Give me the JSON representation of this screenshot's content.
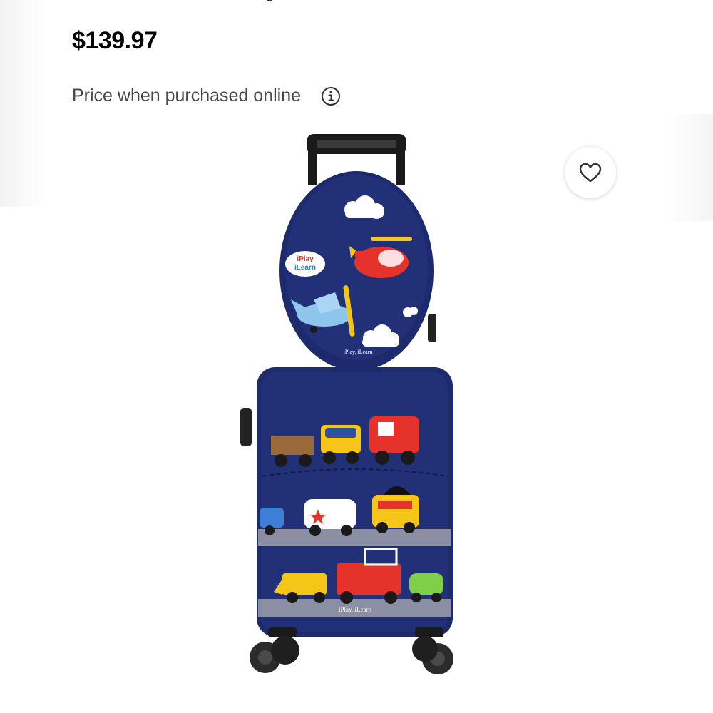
{
  "product": {
    "price": "$139.97",
    "price_note": "Price when purchased online",
    "image_brand_text": "iPlay, iLearn",
    "image_logo_line1": "iPlay",
    "image_logo_line2": "iLearn"
  },
  "icons": {
    "info": "info-icon",
    "favorite": "heart-outline-icon"
  },
  "colors": {
    "price": "#000000",
    "note": "#46474a",
    "suitcase_body": "#1e2a6e"
  }
}
